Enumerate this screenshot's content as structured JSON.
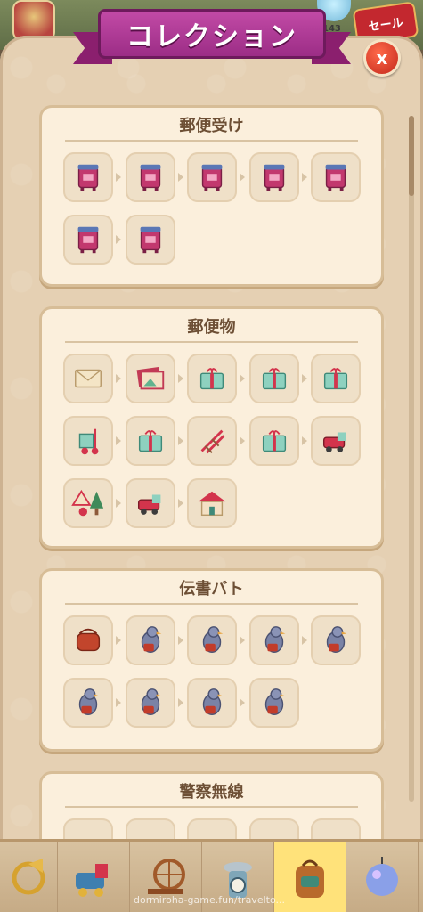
{
  "header": {
    "title": "コレクション",
    "close_label": "x",
    "sale_label": "セール",
    "count_text": "143"
  },
  "sections": [
    {
      "title": "郵便受け",
      "items": [
        "mailbox-1-icon",
        "mailbox-2-icon",
        "mailbox-3-icon",
        "mailbox-4-icon",
        "mailbox-5-icon",
        "mailbox-6-icon",
        "mailbox-7-icon"
      ]
    },
    {
      "title": "郵便物",
      "items": [
        "envelope-icon",
        "photo-postcards-icon",
        "parcel-icon",
        "gift-box-icon",
        "box-stack-icon",
        "hand-truck-icon",
        "open-crate-icon",
        "rail-track-icon",
        "toy-box-icon",
        "toy-train-icon",
        "road-sign-tree-icon",
        "train-set-icon",
        "toy-house-icon"
      ]
    },
    {
      "title": "伝書バト",
      "items": [
        "mail-bag-icon",
        "pigeon-1-icon",
        "pigeon-2-icon",
        "pigeon-3-icon",
        "pigeon-4-icon",
        "pigeon-5-icon",
        "pigeon-6-icon",
        "pigeon-7-icon",
        "pigeon-8-icon"
      ]
    },
    {
      "title": "警察無線",
      "items": []
    }
  ],
  "bottom_tabs": [
    "horn-icon",
    "train-icon",
    "spinning-wheel-icon",
    "scale-icon",
    "backpack-icon",
    "disco-ball-icon"
  ],
  "active_tab": "backpack-icon",
  "watermark": "dormiroha-game.fun/travelto..."
}
